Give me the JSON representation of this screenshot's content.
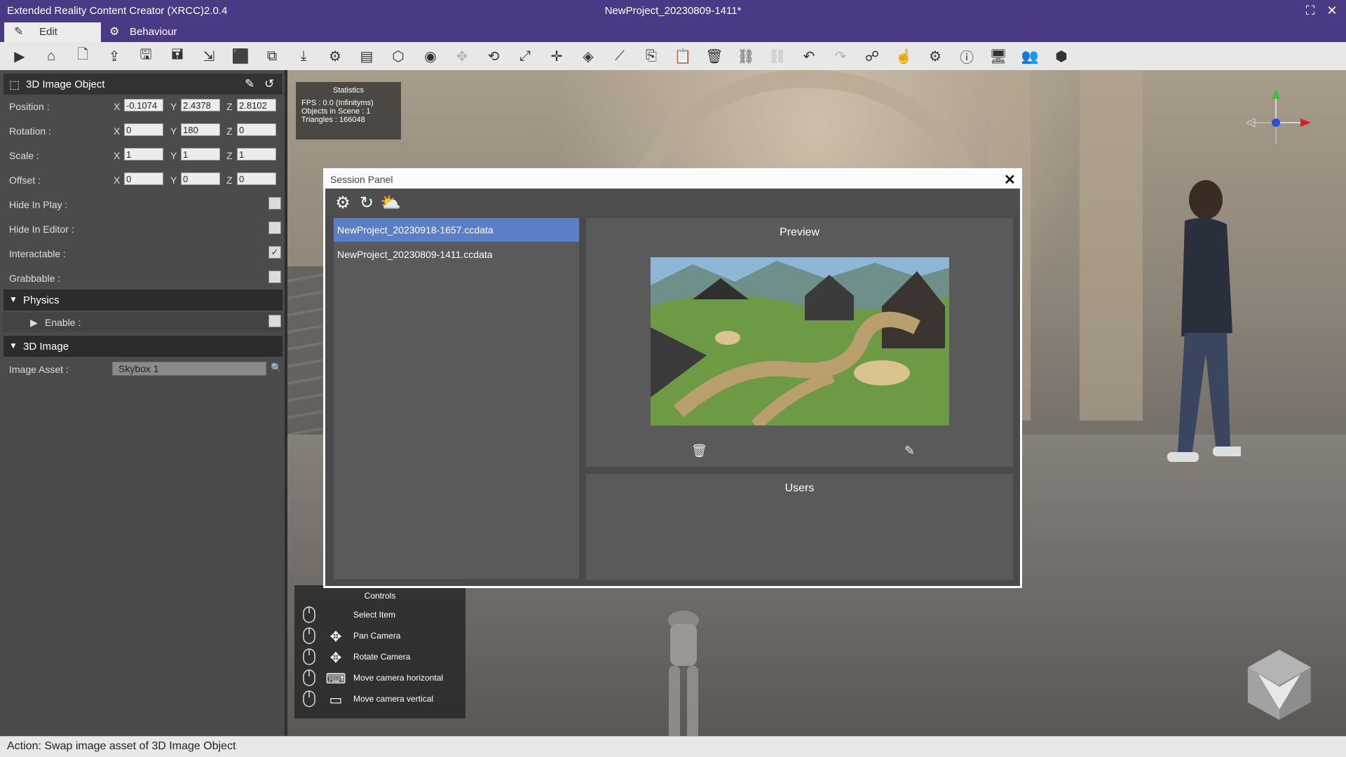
{
  "window": {
    "app_title": "Extended Reality Content Creator (XRCC)2.0.4",
    "project_title": "NewProject_20230809-1411*",
    "maximize_icon": "maximize-icon",
    "close_icon": "close-icon"
  },
  "mode_tabs": [
    {
      "label": "Edit",
      "icon": "edit-icon",
      "active": true
    },
    {
      "label": "Behaviour",
      "icon": "gear-icon",
      "active": false
    }
  ],
  "toolbar": {
    "tools": [
      {
        "name": "play-icon",
        "glyph": "▶",
        "enabled": true
      },
      {
        "name": "home-icon",
        "glyph": "⌂",
        "enabled": true
      },
      {
        "name": "new-project-icon",
        "glyph": "🗋",
        "enabled": true
      },
      {
        "name": "open-project-icon",
        "glyph": "⇪",
        "enabled": true
      },
      {
        "name": "save-icon",
        "glyph": "🖫",
        "enabled": true
      },
      {
        "name": "save-as-icon",
        "glyph": "🖬",
        "enabled": true
      },
      {
        "name": "export-icon",
        "glyph": "⇲",
        "enabled": true
      },
      {
        "name": "box-icon",
        "glyph": "⬛",
        "enabled": true
      },
      {
        "name": "stack-icon",
        "glyph": "⧉",
        "enabled": true
      },
      {
        "name": "import-icon",
        "glyph": "⤓",
        "enabled": true
      },
      {
        "name": "scene-settings-icon",
        "glyph": "⚙",
        "enabled": true
      },
      {
        "name": "layers-icon",
        "glyph": "▤",
        "enabled": true
      },
      {
        "name": "add-object-icon",
        "glyph": "⬡",
        "enabled": true
      },
      {
        "name": "visibility-icon",
        "glyph": "◉",
        "enabled": true
      },
      {
        "name": "move-icon",
        "glyph": "✥",
        "enabled": false
      },
      {
        "name": "rotate-icon",
        "glyph": "⟲",
        "enabled": true
      },
      {
        "name": "scale-icon",
        "glyph": "⤢",
        "enabled": true
      },
      {
        "name": "transform-icon",
        "glyph": "✛",
        "enabled": true
      },
      {
        "name": "cube-icon",
        "glyph": "◈",
        "enabled": true
      },
      {
        "name": "wand-icon",
        "glyph": "⟋",
        "enabled": true
      },
      {
        "name": "copy-icon",
        "glyph": "⎘",
        "enabled": true
      },
      {
        "name": "paste-icon",
        "glyph": "📋",
        "enabled": false
      },
      {
        "name": "delete-icon",
        "glyph": "🗑",
        "enabled": true
      },
      {
        "name": "link-icon",
        "glyph": "⛓",
        "enabled": true
      },
      {
        "name": "unlink-icon",
        "glyph": "⛓",
        "enabled": false
      },
      {
        "name": "undo-icon",
        "glyph": "↶",
        "enabled": true
      },
      {
        "name": "redo-icon",
        "glyph": "↷",
        "enabled": false
      },
      {
        "name": "share-icon",
        "glyph": "☍",
        "enabled": true
      },
      {
        "name": "interaction-icon",
        "glyph": "☝",
        "enabled": true
      },
      {
        "name": "settings-icon",
        "glyph": "⚙",
        "enabled": true
      },
      {
        "name": "info-icon",
        "glyph": "ⓘ",
        "enabled": true
      },
      {
        "name": "monitor-settings-icon",
        "glyph": "🖥",
        "enabled": true
      },
      {
        "name": "users-icon",
        "glyph": "👥",
        "enabled": true
      },
      {
        "name": "unity-icon",
        "glyph": "⬢",
        "enabled": true
      }
    ]
  },
  "inspector": {
    "title": "3D Image Object",
    "object_icon": "cube-icon",
    "edit_icon": "pencil-icon",
    "reset_icon": "reset-icon",
    "transform": [
      {
        "label": "Position :",
        "x": "-0.1074",
        "y": "2.4378",
        "z": "2.8102"
      },
      {
        "label": "Rotation :",
        "x": "0",
        "y": "180",
        "z": "0"
      },
      {
        "label": "Scale :",
        "x": "1",
        "y": "1",
        "z": "1"
      },
      {
        "label": "Offset :",
        "x": "0",
        "y": "0",
        "z": "0"
      }
    ],
    "axis_labels": {
      "x": "X",
      "y": "Y",
      "z": "Z"
    },
    "flags": [
      {
        "label": "Hide In Play :",
        "checked": false
      },
      {
        "label": "Hide In Editor :",
        "checked": false
      },
      {
        "label": "Interactable :",
        "checked": true
      },
      {
        "label": "Grabbable :",
        "checked": false
      }
    ],
    "physics": {
      "section_label": "Physics",
      "enable_label": "Enable :",
      "enabled": false
    },
    "image_section": {
      "section_label": "3D Image",
      "asset_label": "Image Asset :",
      "asset_value": "Skybox 1"
    }
  },
  "viewport": {
    "stats": {
      "title": "Statistics",
      "fps": "FPS : 0.0 (Infinityms)",
      "objects": "Objects in Scene : 1",
      "triangles": "Triangles : 166048"
    },
    "controls": {
      "title": "Controls",
      "items": [
        {
          "label": "Select Item",
          "icon": ""
        },
        {
          "label": "Pan Camera",
          "icon": "✥"
        },
        {
          "label": "Rotate Camera",
          "icon": "✥"
        },
        {
          "label": "Move camera horizontal",
          "icon": "⌨"
        },
        {
          "label": "Move camera vertical",
          "icon": "▭"
        }
      ]
    }
  },
  "session_panel": {
    "title": "Session Panel",
    "close_glyph": "✕",
    "tools": [
      {
        "name": "network-icon",
        "glyph": "⚙"
      },
      {
        "name": "refresh-icon",
        "glyph": "↻"
      },
      {
        "name": "cloud-download-icon",
        "glyph": "⛅"
      }
    ],
    "files": [
      {
        "name": "NewProject_20230918-1657.ccdata",
        "selected": true
      },
      {
        "name": "NewProject_20230809-1411.ccdata",
        "selected": false
      }
    ],
    "preview_title": "Preview",
    "users_title": "Users",
    "delete_glyph": "🗑",
    "edit_glyph": "✎"
  },
  "status_bar": {
    "text": "Action: Swap image asset of 3D Image Object"
  },
  "colors": {
    "title_bar": "#4a3a86",
    "selection": "#5b7fc7",
    "panel": "#4b4b4b"
  }
}
